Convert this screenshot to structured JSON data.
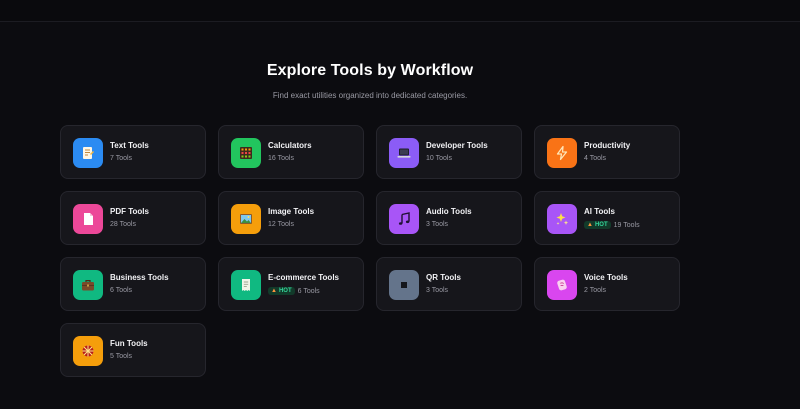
{
  "page": {
    "title": "Explore Tools by Workflow",
    "subtitle": "Find exact utilities organized into dedicated categories."
  },
  "categories": [
    {
      "name": "Text Tools",
      "count": "7 Tools",
      "icon": "document-icon",
      "color": "#2b8bf2"
    },
    {
      "name": "Calculators",
      "count": "16 Tools",
      "icon": "abacus-icon",
      "color": "#22c55e"
    },
    {
      "name": "Developer Tools",
      "count": "10 Tools",
      "icon": "laptop-icon",
      "color": "#8b5cf6"
    },
    {
      "name": "Productivity",
      "count": "4 Tools",
      "icon": "lightning-icon",
      "color": "#f97316"
    },
    {
      "name": "PDF Tools",
      "count": "28 Tools",
      "icon": "pdf-file-icon",
      "color": "#ec4899"
    },
    {
      "name": "Image Tools",
      "count": "12 Tools",
      "icon": "picture-icon",
      "color": "#f59e0b"
    },
    {
      "name": "Audio Tools",
      "count": "3 Tools",
      "icon": "music-note-icon",
      "color": "#a855f7"
    },
    {
      "name": "AI Tools",
      "count": "19 Tools",
      "icon": "sparkles-icon",
      "color": "#a855f7",
      "badge": "HOT"
    },
    {
      "name": "Business Tools",
      "count": "6 Tools",
      "icon": "briefcase-icon",
      "color": "#10b981"
    },
    {
      "name": "E-commerce Tools",
      "count": "6 Tools",
      "icon": "receipt-icon",
      "color": "#10b981",
      "badge": "HOT"
    },
    {
      "name": "QR Tools",
      "count": "3 Tools",
      "icon": "qr-square-icon",
      "color": "#64748b"
    },
    {
      "name": "Voice Tools",
      "count": "2 Tools",
      "icon": "voice-icon",
      "color": "#d946ef"
    },
    {
      "name": "Fun Tools",
      "count": "5 Tools",
      "icon": "spinner-wheel-icon",
      "color": "#f59e0b"
    }
  ],
  "colors": {
    "background": "#0c0c10",
    "card": "#16161b",
    "hot_badge_bg": "#123a2a",
    "hot_badge_text": "#34d399"
  }
}
